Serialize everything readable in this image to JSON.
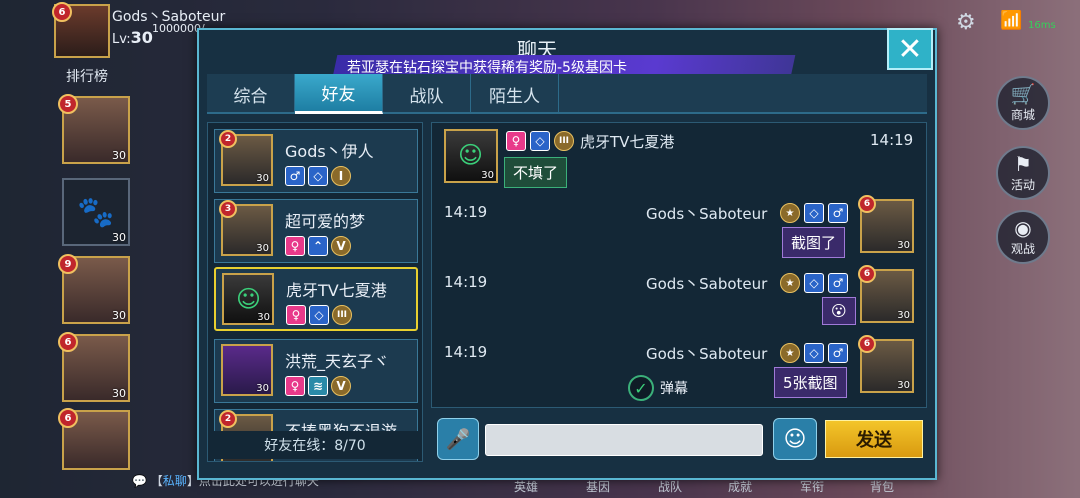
{
  "hud": {
    "player_name": "Gods丶Saboteur",
    "level_label": "Lv:",
    "level": "30",
    "exp": "1000000/",
    "badge": "6",
    "ping": "16ms"
  },
  "rank": {
    "title": "排行榜",
    "slots": [
      {
        "badge": "5",
        "level": "30"
      },
      {
        "level": "30"
      },
      {
        "badge": "9",
        "level": "30"
      },
      {
        "badge": "6",
        "level": "30"
      },
      {
        "badge": "6"
      }
    ]
  },
  "side": {
    "shop": "商城",
    "activity": "活动",
    "spectate": "观战"
  },
  "bottom": {
    "hint_prefix": "【",
    "hint_private": "私聊",
    "hint_rest": "】点击此处可以进行聊天",
    "nav": [
      "英雄",
      "基因",
      "战队",
      "成就",
      "军衔",
      "背包"
    ]
  },
  "chat": {
    "title": "聊天",
    "banner": "若亚瑟在钻石探宝中获得稀有奖励-5级基因卡",
    "tabs": [
      "综合",
      "好友",
      "战队",
      "陌生人"
    ],
    "active_tab": "好友",
    "friends": [
      {
        "name": "Gods丶伊人",
        "badge": "2",
        "level": "30",
        "rank": "I"
      },
      {
        "name": "超可爱的梦",
        "badge": "3",
        "level": "30",
        "rank": "V"
      },
      {
        "name": "虎牙TV七夏港",
        "level": "30",
        "rank": "III"
      },
      {
        "name": "洪荒_天玄子ヾ",
        "level": "30",
        "rank": "V"
      },
      {
        "name": "不揍黑狗不退游",
        "badge": "2"
      }
    ],
    "online_label": "好友在线：",
    "online_count": "8/70",
    "messages": [
      {
        "side": "left",
        "name": "虎牙TV七夏港",
        "time": "14:19",
        "text": "不填了",
        "level": "30"
      },
      {
        "side": "right",
        "name": "Gods丶Saboteur",
        "time": "14:19",
        "text": "截图了",
        "level": "30",
        "badge": "6"
      },
      {
        "side": "right",
        "name": "Gods丶Saboteur",
        "time": "14:19",
        "text": "😮",
        "level": "30",
        "badge": "6"
      },
      {
        "side": "right",
        "name": "Gods丶Saboteur",
        "time": "14:19",
        "text": "5张截图",
        "level": "30",
        "badge": "6"
      }
    ],
    "danmu_label": "弹幕",
    "input_value": "",
    "send_label": "发送"
  },
  "colors": {
    "accent": "#2fb2c8",
    "panel": "#173042",
    "selected_border": "#e8d030",
    "send": "#f3c52a"
  }
}
